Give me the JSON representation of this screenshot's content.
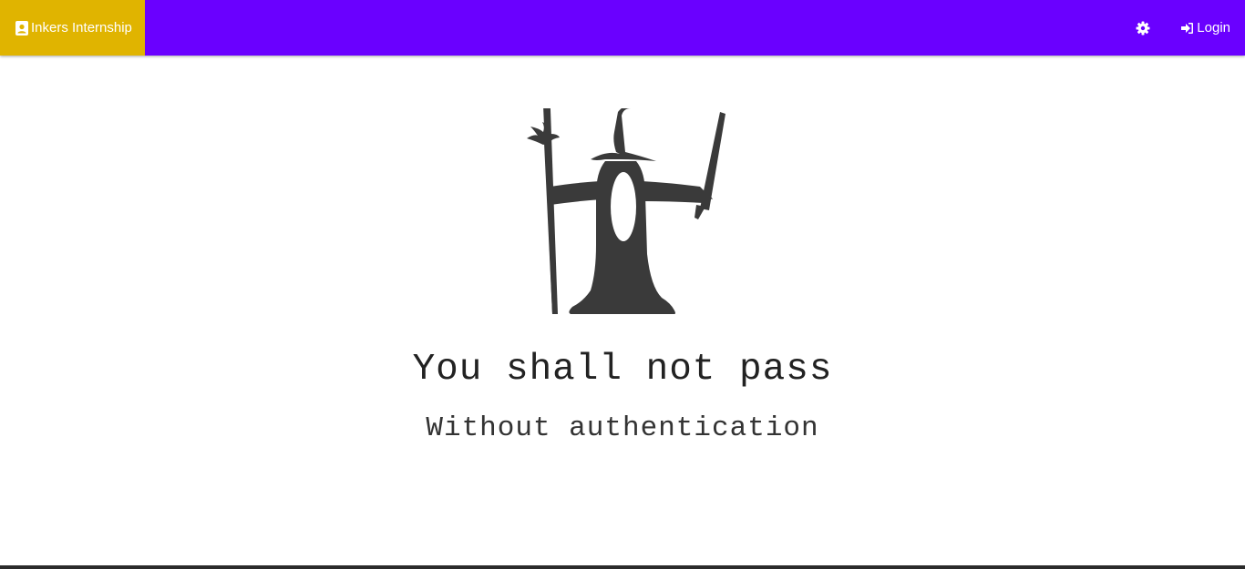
{
  "navbar": {
    "brand_label": "Inkers Internship",
    "brand_icon": "contact-card-icon",
    "settings_icon": "gear-icon",
    "login_label": "Login",
    "login_icon": "sign-in-icon",
    "colors": {
      "navbar_bg": "#6a00ff",
      "brand_bg": "#e0b400",
      "text": "#ffffff"
    }
  },
  "main": {
    "illustration": "wizard-illustration",
    "headline": "You shall not pass",
    "subline": "Without authentication",
    "colors": {
      "illustration": "#3a3a3a",
      "text": "#222222"
    }
  }
}
